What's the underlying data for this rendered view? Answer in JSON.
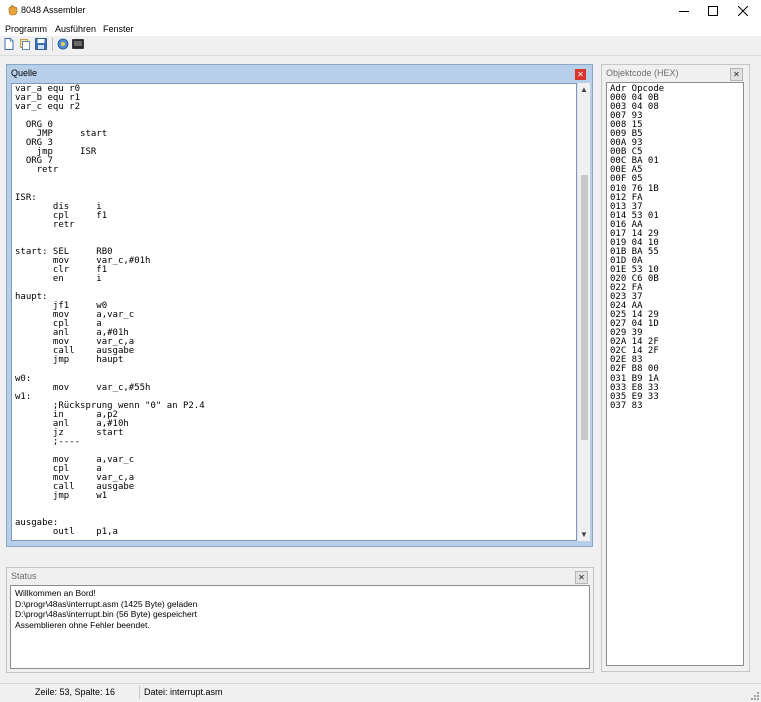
{
  "window": {
    "title": "8048 Assembler",
    "icon": "hand-pointer-icon"
  },
  "menu": {
    "items": [
      "Programm",
      "Ausführen",
      "Fenster"
    ]
  },
  "toolbar": {
    "icons": [
      "new-file-icon",
      "open-file-icon",
      "save-file-icon",
      "assemble-icon",
      "output-window-icon"
    ]
  },
  "source_panel": {
    "title": "Quelle",
    "code": "var_a equ r0\nvar_b equ r1\nvar_c equ r2\n\n  ORG 0\n    JMP     start\n  ORG 3\n    jmp     ISR\n  ORG 7\n    retr\n\n\nISR:\n       dis     i\n       cpl     f1\n       retr\n\n\nstart: SEL     RB0\n       mov     var_c,#01h\n       clr     f1\n       en      i\n\nhaupt:\n       jf1     w0\n       mov     a,var_c\n       cpl     a\n       anl     a,#01h\n       mov     var_c,a\n       call    ausgabe\n       jmp     haupt\n\nw0:\n       mov     var_c,#55h\nw1:\n       ;Rücksprung wenn \"0\" an P2.4\n       in      a,p2\n       anl     a,#10h\n       jz      start\n       ;----\n\n       mov     a,var_c\n       cpl     a\n       mov     var_c,a\n       call    ausgabe\n       jmp     w1\n\n\nausgabe:\n       outl    p1,a"
  },
  "objectcode_panel": {
    "title": "Objektcode (HEX)",
    "header": "Adr Opcode",
    "rows": [
      "000 04 0B",
      "003 04 08",
      "007 93",
      "008 15",
      "009 B5",
      "00A 93",
      "00B C5",
      "00C BA 01",
      "00E A5",
      "00F 05",
      "010 76 1B",
      "012 FA",
      "013 37",
      "014 53 01",
      "016 AA",
      "017 14 29",
      "019 04 10",
      "01B BA 55",
      "01D 0A",
      "01E 53 10",
      "020 C6 0B",
      "022 FA",
      "023 37",
      "024 AA",
      "025 14 29",
      "027 04 1D",
      "029 39",
      "02A 14 2F",
      "02C 14 2F",
      "02E 83",
      "02F B8 00",
      "031 B9 1A",
      "033 E8 33",
      "035 E9 33",
      "037 83"
    ]
  },
  "status_panel": {
    "title": "Status",
    "lines": [
      "Willkommen an Bord!",
      "D:\\progr\\48as\\interrupt.asm (1425 Byte) geladen",
      "D:\\progr\\48as\\interrupt.bin (56 Byte) gespeichert",
      "Assemblieren ohne Fehler beendet."
    ]
  },
  "statusbar": {
    "position": "Zeile: 53, Spalte: 16",
    "file": "Datei: interrupt.asm"
  }
}
